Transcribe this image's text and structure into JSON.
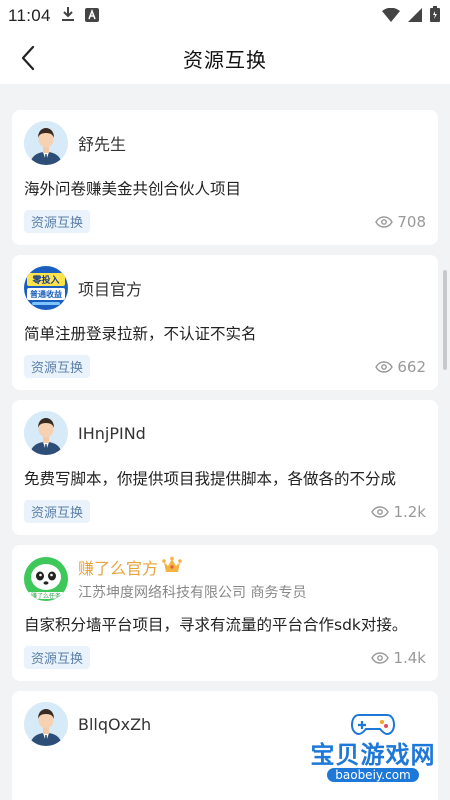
{
  "status_bar": {
    "time": "11:04",
    "icons": [
      "download-icon",
      "a-icon",
      "wifi-icon",
      "signal-icon",
      "battery-icon"
    ]
  },
  "nav": {
    "title": "资源互换",
    "back_icon": "back-arrow-icon"
  },
  "posts": [
    {
      "author": "舒先生",
      "avatar": "default-male-avatar",
      "content": "海外问卷赚美金共创合伙人项目",
      "tag": "资源互换",
      "views": "708"
    },
    {
      "author": "项目官方",
      "avatar": "project-logo-avatar",
      "avatar_text": [
        "零投入",
        "普通收益"
      ],
      "content": "简单注册登录拉新，不认证不实名",
      "tag": "资源互换",
      "views": "662"
    },
    {
      "author": "IHnjPINd",
      "avatar": "default-male-avatar",
      "content": "免费写脚本，你提供项目我提供脚本，各做各的不分成",
      "tag": "资源互换",
      "views": "1.2k"
    },
    {
      "author": "赚了么官方",
      "avatar": "panda-app-avatar",
      "avatar_text": "赚了么任务",
      "badge_icon": "crown-icon",
      "subtitle": "江苏坤度网络科技有限公司  商务专员",
      "content": "自家积分墙平台项目，寻求有流量的平台合作sdk对接。",
      "tag": "资源互换",
      "views": "1.4k"
    },
    {
      "author": "BllqOxZh",
      "avatar": "default-male-avatar"
    }
  ],
  "watermark": {
    "title": "宝贝游戏网",
    "url": "baobeiy.com"
  },
  "colors": {
    "accent": "#1e78d8",
    "tag_bg": "#eaf3fb",
    "official_name": "#e8a33c",
    "page_bg": "#f2f3f5"
  }
}
